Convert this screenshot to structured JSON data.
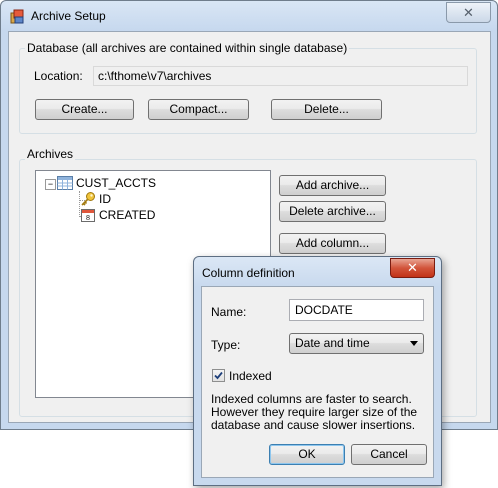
{
  "window": {
    "title": "Archive Setup",
    "close_glyph": "✕"
  },
  "database": {
    "group_label": "Database (all archives are contained within single database)",
    "location_label": "Location:",
    "location_value": "c:\\fthome\\v7\\archives",
    "create_label": "Create...",
    "compact_label": "Compact...",
    "delete_label": "Delete..."
  },
  "archives": {
    "group_label": "Archives",
    "tree": {
      "root": {
        "label": "CUST_ACCTS",
        "icon": "table-icon",
        "expander": "−"
      },
      "children": [
        {
          "label": "ID",
          "icon": "key-icon"
        },
        {
          "label": "CREATED",
          "icon": "calendar-icon"
        }
      ]
    },
    "add_archive_label": "Add archive...",
    "delete_archive_label": "Delete archive...",
    "add_column_label": "Add column..."
  },
  "dialog": {
    "title": "Column definition",
    "close_glyph": "✕",
    "name_label": "Name:",
    "name_value": "DOCDATE",
    "type_label": "Type:",
    "type_value": "Date and time",
    "indexed_label": "Indexed",
    "indexed_checked": true,
    "description_lines": [
      "Indexed columns are faster to search.",
      "However they require larger size of the",
      "database and cause slower insertions."
    ],
    "ok_label": "OK",
    "cancel_label": "Cancel"
  },
  "colors": {
    "accent": "#3c7fb1",
    "close_red": "#c23218",
    "frame": "#c6d8ee"
  }
}
